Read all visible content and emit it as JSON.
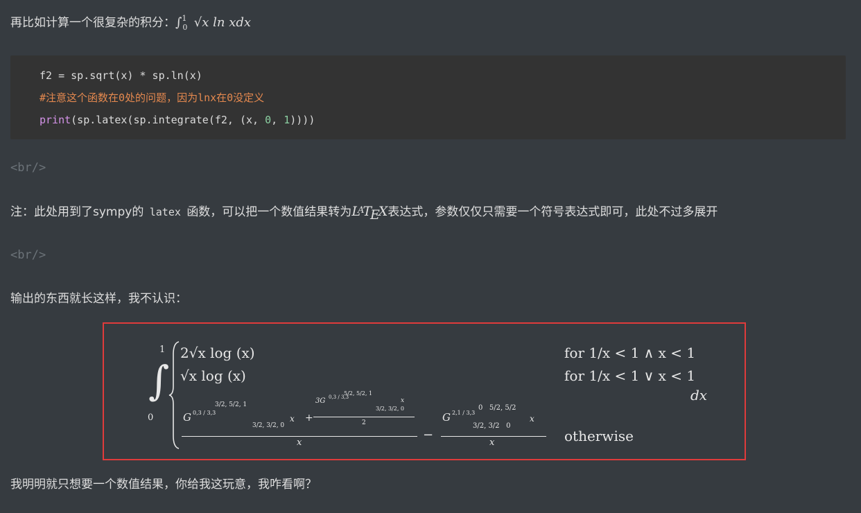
{
  "intro": {
    "text": "再比如计算一个很复杂的积分：",
    "formula_integral": "∫",
    "formula_upper": "1",
    "formula_lower": "0",
    "formula_body": "√x ln xdx"
  },
  "code": {
    "line1": "f2 = sp.sqrt(x) * sp.ln(x)",
    "line2": "#注意这个函数在0处的问题，因为lnx在0没定义",
    "line3_print": "print",
    "line3_a": "(sp.latex(sp.integrate(f2, (x, ",
    "line3_n0": "0",
    "line3_b": ", ",
    "line3_n1": "1",
    "line3_c": "))))"
  },
  "br_tag": "<br/>",
  "note": {
    "prefix": "注：此处用到了sympy的",
    "code": "latex",
    "mid": "函数，可以把一个数值结果转为",
    "latex_L": "L",
    "latex_A": "A",
    "latex_T": "T",
    "latex_E": "E",
    "latex_X": "X",
    "suffix": "表达式，参数仅仅只需要一个符号表达式即可，此处不过多展开"
  },
  "output_intro": "输出的东西就长这样，我不认识：",
  "rendered_output": {
    "upper_limit": "1",
    "lower_limit": "0",
    "case1_expr": "2√x log (x)",
    "case1_cond": "for 1/x < 1 ∧ x < 1",
    "case2_expr": "√x log (x)",
    "case2_cond": "for 1/x < 1 ∨ x < 1",
    "dx": "dx",
    "case3_cond": "otherwise",
    "meijer_g1": "G",
    "meijer_g1_idx": "0,3 / 3,3",
    "meijer_g1_top": "3/2, 5/2, 1",
    "meijer_g1_bot": "3/2, 3/2, 0",
    "meijer_g1_arg": "x",
    "meijer_g2_coef": "3G",
    "meijer_g2_idx": "0,3 / 3,3",
    "meijer_g2_top": "5/2, 5/2, 1",
    "meijer_g2_bot": "3/2, 3/2, 0",
    "meijer_g2_arg": "x",
    "meijer_g2_den": "2",
    "denominator_x": "x",
    "meijer_g3": "G",
    "meijer_g3_idx": "2,1 / 3,3",
    "meijer_g3_top": "0   5/2, 5/2",
    "meijer_g3_bot": "3/2, 3/2   0",
    "meijer_g3_arg": "x",
    "denominator_x2": "x",
    "plus": "+",
    "minus": "−"
  },
  "closing": "我明明就只想要一个数值结果，你给我这玩意，我咋看啊？",
  "colors": {
    "background": "#363b40",
    "code_background": "#333333",
    "highlight_border": "#e03b3b",
    "comment": "#e5894f",
    "keyword": "#d493e8",
    "number": "#8cd0a2"
  }
}
